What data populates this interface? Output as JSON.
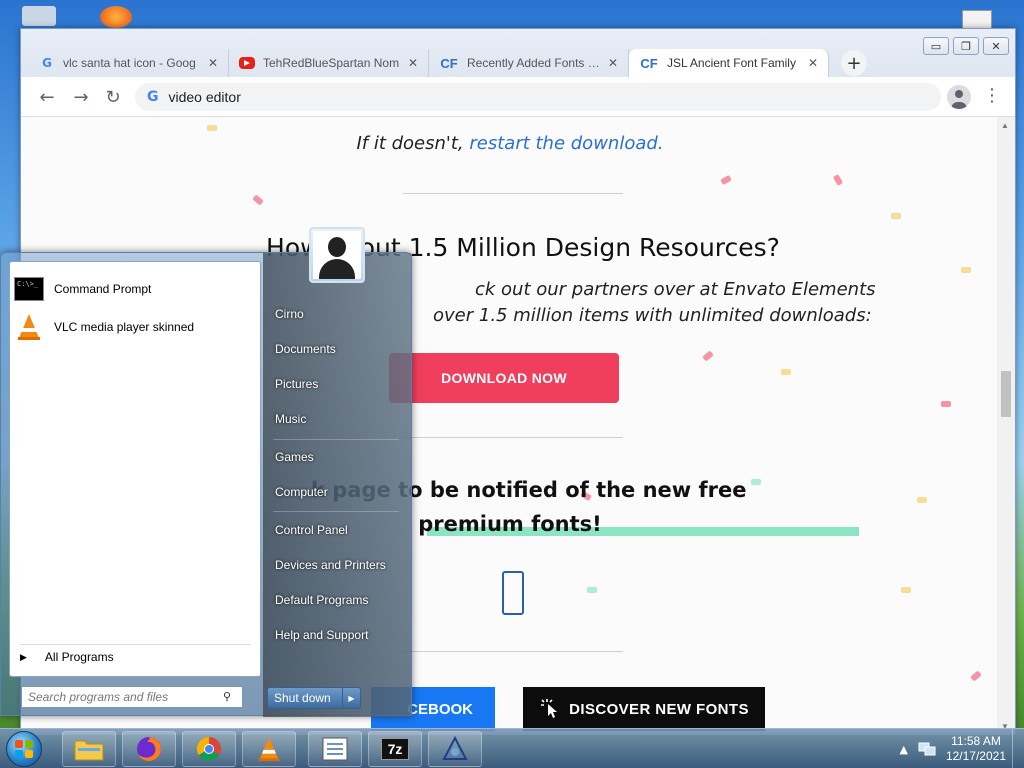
{
  "browser": {
    "tabs": [
      {
        "icon": "google-icon",
        "title": "vlc santa hat icon - Goog",
        "active": false
      },
      {
        "icon": "youtube-icon",
        "title": "TehRedBlueSpartan Nom",
        "active": false
      },
      {
        "icon": "cf-icon",
        "title": "Recently Added Fonts Fo",
        "active": false
      },
      {
        "icon": "cf-icon",
        "title": "JSL Ancient Font Family",
        "active": true
      }
    ],
    "favicon_google": "G",
    "favicon_cf": "CF",
    "new_tab": "+",
    "close_glyph": "✕",
    "window_controls": {
      "minimize": "▭",
      "restore": "❐",
      "close": "✕"
    },
    "nav": {
      "back": "←",
      "forward": "→",
      "reload": "↻",
      "menu": "⋮"
    },
    "address": "video editor"
  },
  "page": {
    "restart_prefix": "If it doesn't, ",
    "restart_link": "restart the download.",
    "design_heading": "How about 1.5 Million Design Resources?",
    "design_sub1": "ck out our partners over at Envato Elements",
    "design_sub2": "over 1.5 million items with unlimited downloads:",
    "download_button": "DOWNLOAD NOW",
    "fb_heading_line1": "k page to be notified of the new free",
    "fb_heading_line2": "premium fonts!",
    "facebook_button": "CEBOOK",
    "discover_button": "DISCOVER NEW FONTS"
  },
  "start_menu": {
    "programs": [
      {
        "icon": "command-prompt-icon",
        "label": "Command Prompt"
      },
      {
        "icon": "vlc-icon",
        "label": "VLC media player skinned"
      }
    ],
    "cmd_icon_text": "C:\\>_",
    "all_programs": "All Programs",
    "search_placeholder": "Search programs and files",
    "links": [
      "Cirno",
      "Documents",
      "Pictures",
      "Music",
      "Games",
      "Computer",
      "Control Panel",
      "Devices and Printers",
      "Default Programs",
      "Help and Support"
    ],
    "shutdown": "Shut down"
  },
  "taskbar": {
    "time": "11:58 AM",
    "date": "12/17/2021",
    "apps": [
      "explorer-icon",
      "firefox-icon",
      "chrome-icon",
      "vlc-icon",
      "notepad-icon",
      "7zip-icon",
      "app-icon"
    ],
    "seven_zip_label": "7z"
  },
  "colors": {
    "download_button": "#ef3f5c",
    "facebook_button": "#1877f2",
    "discover_button": "#0c0c0c",
    "link": "#2a6fd6",
    "highlight": "#6fe0b5"
  }
}
